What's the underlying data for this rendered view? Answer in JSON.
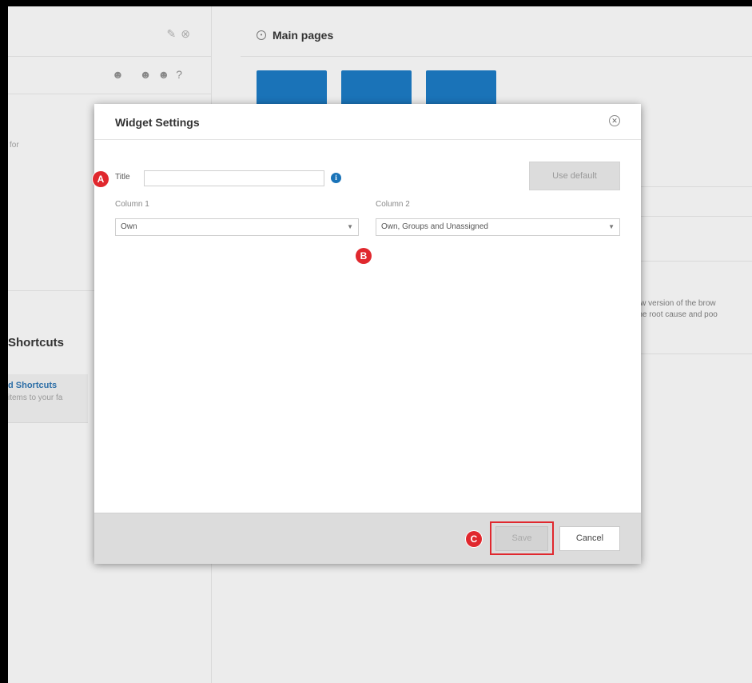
{
  "background": {
    "left_for_text": "for",
    "shortcuts_title": "Shortcuts",
    "shortcut_card": {
      "name": "d Shortcuts",
      "description": "items to your fa"
    },
    "main_pages_title": "Main pages",
    "news_lines": [
      "new version of the brow",
      "t the root cause and poo"
    ]
  },
  "modal": {
    "title": "Widget Settings",
    "title_field_label": "Title",
    "title_field_value": "",
    "use_default_label": "Use default",
    "column1": {
      "label": "Column 1",
      "selected": "Own"
    },
    "column2": {
      "label": "Column 2",
      "selected": "Own, Groups and Unassigned"
    },
    "save_label": "Save",
    "cancel_label": "Cancel"
  },
  "annotations": {
    "a": "A",
    "b": "B",
    "c": "C"
  },
  "colors": {
    "accent": "#1a73b8",
    "marker": "#e0282e"
  }
}
